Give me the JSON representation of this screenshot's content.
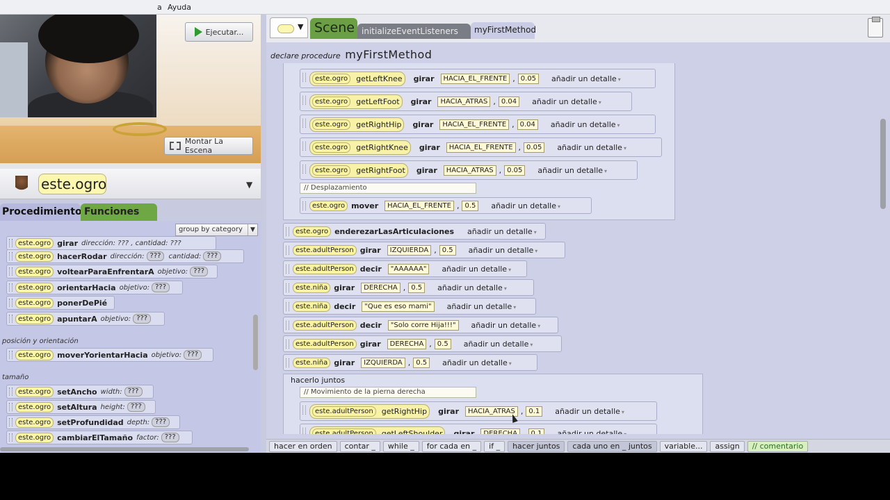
{
  "menu": {
    "partial_left": "a",
    "help": "Ayuda"
  },
  "scene": {
    "run_label": "Ejecutar...",
    "mount_label": "Montar La Escena"
  },
  "selector": {
    "object": "este.ogro"
  },
  "tabs": {
    "procedures": "Procedimiento",
    "functions": "Funciones"
  },
  "palette": {
    "group_by": "group by category",
    "rows": [
      {
        "obj": "este.ogro",
        "method": "girar",
        "params": "dirección:  ???  , cantidad:  ???"
      },
      {
        "obj": "este.ogro",
        "method": "hacerRodar",
        "p1": "dirección:",
        "v1": "???",
        "p2": "cantidad:",
        "v2": "???"
      },
      {
        "obj": "este.ogro",
        "method": "voltearParaEnfrentarA",
        "p1": "objetivo:",
        "v1": "???"
      },
      {
        "obj": "este.ogro",
        "method": "orientarHacia",
        "p1": "objetivo:",
        "v1": "???"
      },
      {
        "obj": "este.ogro",
        "method": "ponerDePié"
      },
      {
        "obj": "este.ogro",
        "method": "apuntarA",
        "p1": "objetivo:",
        "v1": "???"
      }
    ],
    "cat_position": "posición y orientación",
    "row_move": {
      "obj": "este.ogro",
      "method": "moverYorientarHacia",
      "p1": "objetivo:",
      "v1": "???"
    },
    "cat_size": "tamaño",
    "size_rows": [
      {
        "obj": "este.ogro",
        "method": "setAncho",
        "p1": "width:",
        "v1": "???"
      },
      {
        "obj": "este.ogro",
        "method": "setAltura",
        "p1": "height:",
        "v1": "???"
      },
      {
        "obj": "este.ogro",
        "method": "setProfundidad",
        "p1": "depth:",
        "v1": "???"
      },
      {
        "obj": "este.ogro",
        "method": "cambiarElTamaño",
        "p1": "factor:",
        "v1": "???"
      }
    ]
  },
  "editor": {
    "tab_scene": "Scene",
    "tab_init": "initializeEventListeners",
    "tab_method": "myFirstMethod",
    "declare_prefix": "declare procedure",
    "declare_name": "myFirstMethod",
    "detail": "añadir un detalle",
    "inner_rows": [
      {
        "obj": "este.ogro",
        "getter": "getLeftKnee",
        "method": "girar",
        "dir": "HACIA_EL_FRENTE",
        "amt": "0.05"
      },
      {
        "obj": "este.ogro",
        "getter": "getLeftFoot",
        "method": "girar",
        "dir": "HACIA_ATRAS",
        "amt": "0.04"
      },
      {
        "obj": "este.ogro",
        "getter": "getRightHip",
        "method": "girar",
        "dir": "HACIA_EL_FRENTE",
        "amt": "0.04"
      },
      {
        "obj": "este.ogro",
        "getter": "getRightKnee",
        "method": "girar",
        "dir": "HACIA_EL_FRENTE",
        "amt": "0.05"
      },
      {
        "obj": "este.ogro",
        "getter": "getRightFoot",
        "method": "girar",
        "dir": "HACIA_ATRAS",
        "amt": "0.05"
      }
    ],
    "comment_move": "// Desplazamiento",
    "move_row": {
      "obj": "este.ogro",
      "method": "mover",
      "dir": "HACIA_EL_FRENTE",
      "amt": "0.5"
    },
    "outer_rows": [
      {
        "obj": "este.ogro",
        "method": "enderezarLasArticulaciones"
      },
      {
        "obj": "este.adultPerson",
        "method": "girar",
        "dir": "IZQUIERDA",
        "amt": "0.5"
      },
      {
        "obj": "este.adultPerson",
        "method": "decir",
        "text": "\"AAAAAA\""
      },
      {
        "obj": "este.niña",
        "method": "girar",
        "dir": "DERECHA",
        "amt": "0.5"
      },
      {
        "obj": "este.niña",
        "method": "decir",
        "text": "\"Que es eso mami\""
      },
      {
        "obj": "este.adultPerson",
        "method": "decir",
        "text": "\"Solo corre Hija!!!\""
      },
      {
        "obj": "este.adultPerson",
        "method": "girar",
        "dir": "DERECHA",
        "amt": "0.5"
      },
      {
        "obj": "este.niña",
        "method": "girar",
        "dir": "IZQUIERDA",
        "amt": "0.5"
      }
    ],
    "together_label": "hacerlo juntos",
    "comment_leg": "// Movimiento de la pierna derecha",
    "together_rows": [
      {
        "obj": "este.adultPerson",
        "getter": "getRightHip",
        "method": "girar",
        "dir": "HACIA_ATRAS",
        "amt": "0.1"
      },
      {
        "obj": "este.adultPerson",
        "getter": "getLeftShoulder",
        "method": "girar",
        "dir": "DERECHA",
        "amt": "0.1"
      }
    ]
  },
  "bottom": [
    "hacer en orden",
    "contar _",
    "while _",
    "for cada en _",
    "if _",
    "hacer juntos",
    "cada uno en _ juntos",
    "variable...",
    "assign",
    "// comentario"
  ]
}
